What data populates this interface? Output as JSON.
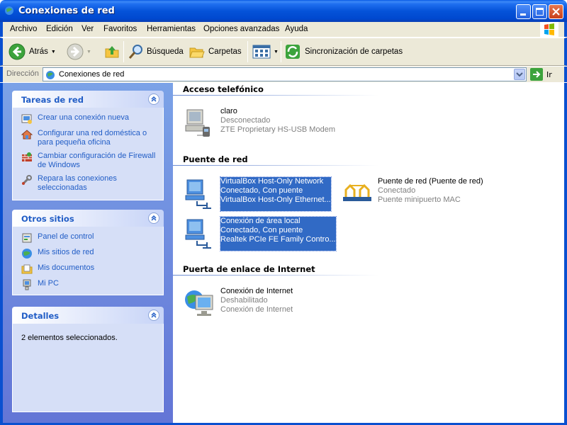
{
  "window": {
    "title": "Conexiones de red"
  },
  "menu": [
    "Archivo",
    "Edición",
    "Ver",
    "Favoritos",
    "Herramientas",
    "Opciones avanzadas",
    "Ayuda"
  ],
  "toolbar": {
    "back_label": "Atrás",
    "search_label": "Búsqueda",
    "folders_label": "Carpetas",
    "sync_label": "Sincronización de carpetas"
  },
  "address": {
    "label": "Dirección",
    "value": "Conexiones de red",
    "go_label": "Ir"
  },
  "left": {
    "tasks": {
      "title": "Tareas de red",
      "links": [
        "Crear una conexión nueva",
        "Configurar una red doméstica o para pequeña oficina",
        "Cambiar configuración de Firewall de Windows",
        "Repara las conexiones seleccionadas"
      ]
    },
    "other": {
      "title": "Otros sitios",
      "links": [
        "Panel de control",
        "Mis sitios de red",
        "Mis documentos",
        "Mi PC"
      ]
    },
    "details": {
      "title": "Detalles",
      "text": "2 elementos seleccionados."
    }
  },
  "groups": {
    "dialup": {
      "title": "Acceso telefónico",
      "items": [
        {
          "name": "claro",
          "status": "Desconectado",
          "device": "ZTE Proprietary HS-USB Modem"
        }
      ]
    },
    "bridge": {
      "title": "Puente de red",
      "items": [
        {
          "name": "VirtualBox Host-Only Network",
          "status": "Conectado, Con puente",
          "device": "VirtualBox Host-Only Ethernet...",
          "selected": true
        },
        {
          "name": "Puente de red (Puente de red)",
          "status": "Conectado",
          "device": "Puente minipuerto MAC"
        },
        {
          "name": "Conexión de área local",
          "status": "Conectado, Con puente",
          "device": "Realtek PCIe FE Family Contro...",
          "selected": true
        }
      ]
    },
    "gateway": {
      "title": "Puerta de enlace de Internet",
      "items": [
        {
          "name": "Conexión de Internet",
          "status": "Deshabilitado",
          "device": "Conexión de Internet"
        }
      ]
    }
  }
}
